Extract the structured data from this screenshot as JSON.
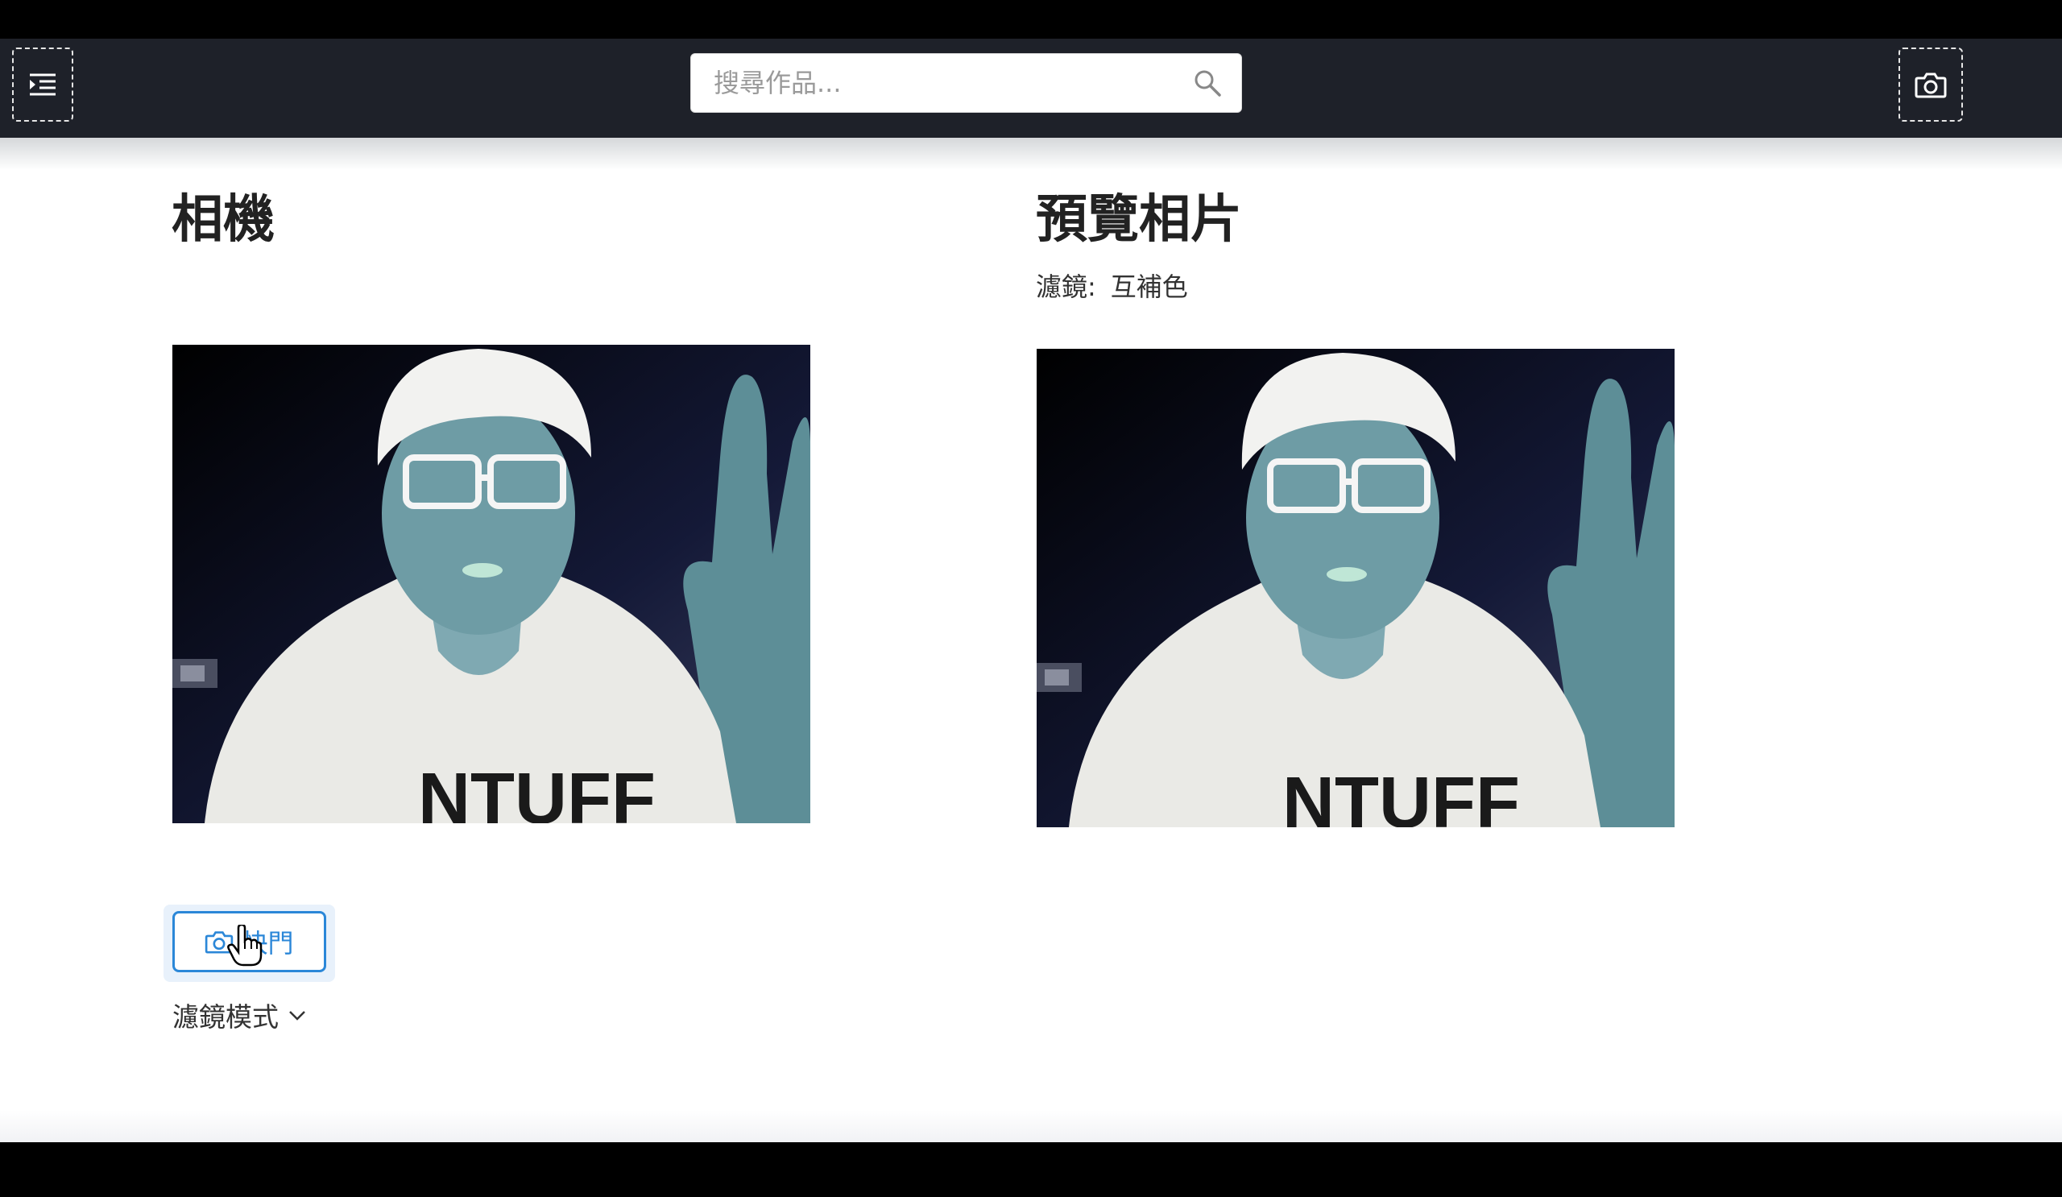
{
  "search": {
    "placeholder": "搜尋作品..."
  },
  "camera_section": {
    "title": "相機",
    "shutter_label": "快門",
    "filter_mode_label": "濾鏡模式"
  },
  "preview_section": {
    "title": "預覽相片",
    "filter_label": "濾鏡:",
    "filter_value": "互補色"
  },
  "photo": {
    "shirt_text": "NTUFF"
  },
  "colors": {
    "navbar": "#1e2129",
    "accent": "#2b87d8",
    "text": "#222222"
  }
}
